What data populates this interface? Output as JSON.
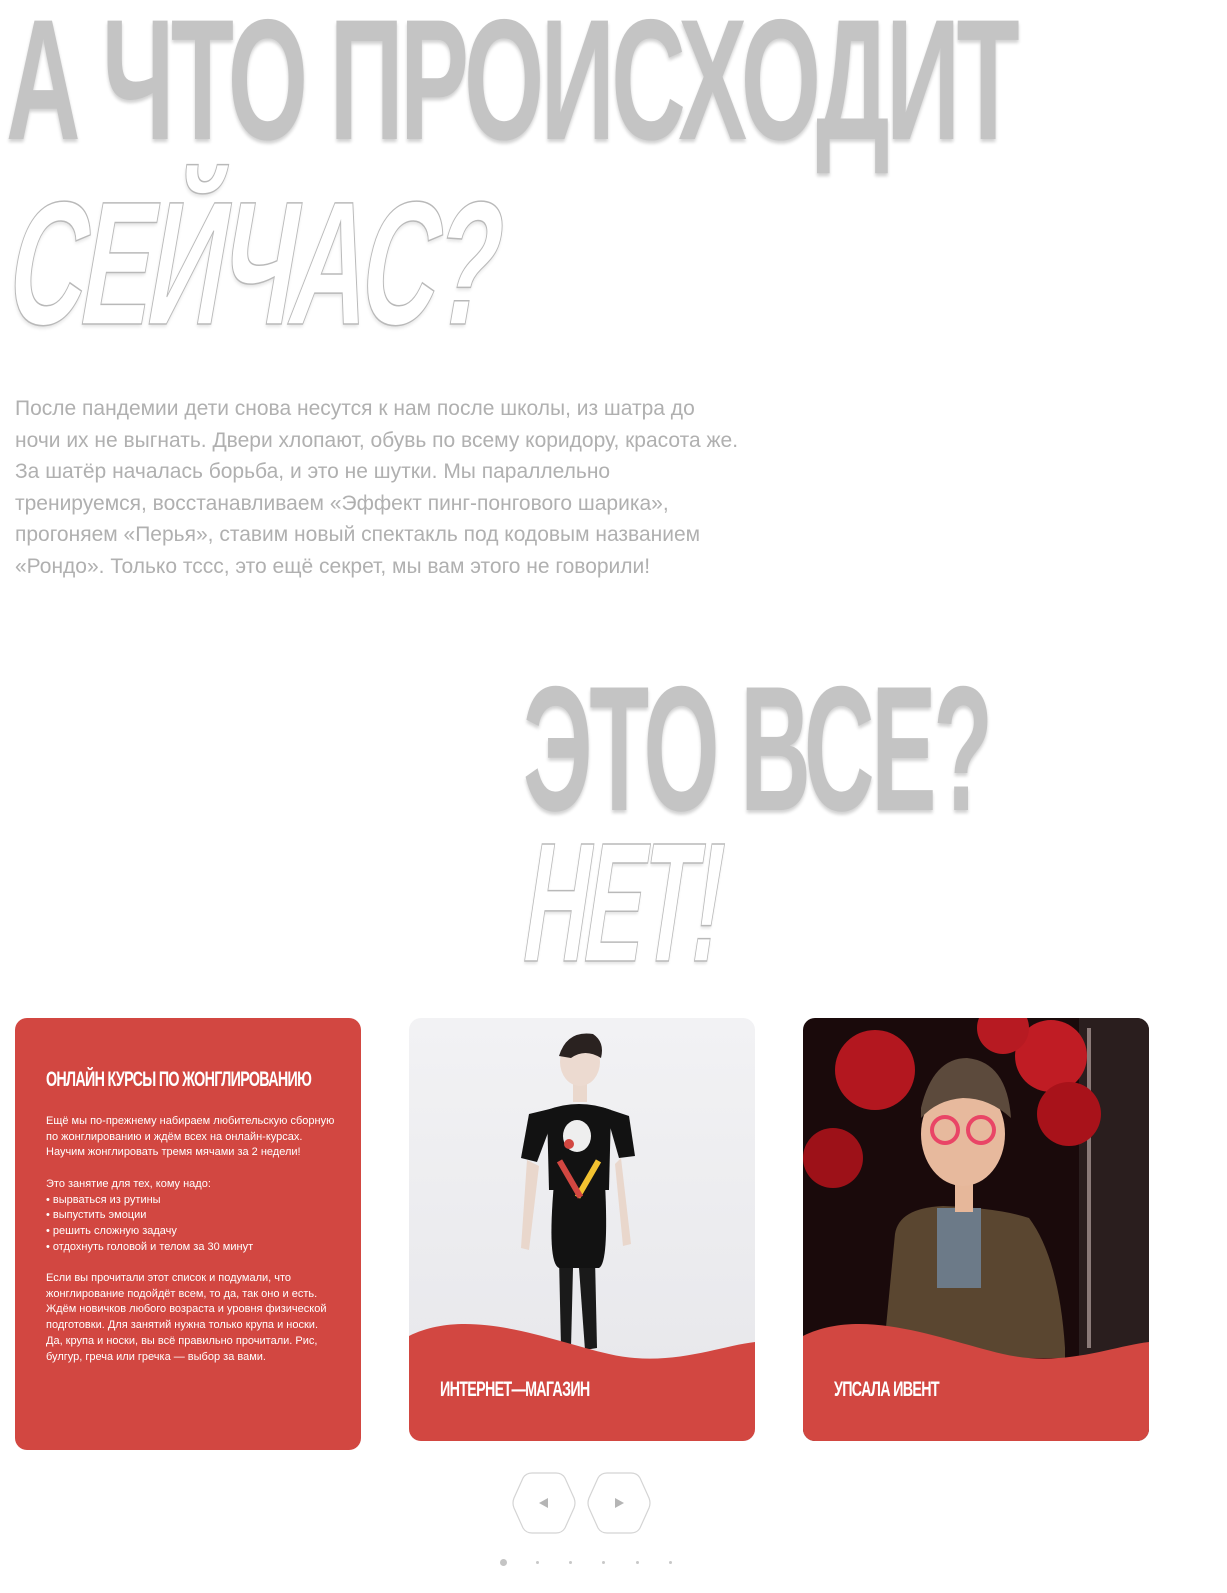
{
  "hero": {
    "line1": "А что происходит",
    "line2": "сейчас?"
  },
  "intro_text": "После пандемии дети снова несутся к нам после школы, из шатра до ночи их не выгнать. Двери хлопают, обувь по всему коридору, красота же. За шатёр началась борьба, и это не шутки. Мы параллельно тренируемся, восстанавливаем «Эффект пинг-понгового шарика», прогоняем «Перья», ставим новый спектакль под кодовым названием «Рондо». Только тссс, это ещё секрет, мы вам этого не говорили!",
  "section2": {
    "line1": "Это все?",
    "line2": "Нет!"
  },
  "cards": {
    "courses": {
      "title": "Онлайн курсы по жонглированию",
      "paragraph1": "Ещё мы по-прежнему набираем любительскую сборную по жонглированию и ждём всех на онлайн-курсах. Научим жонглировать тремя мячами за 2 недели!",
      "paragraph2": "Это занятие для тех, кому надо:",
      "bullets": [
        "вырваться из рутины",
        "выпустить эмоции",
        "решить сложную задачу",
        "отдохнуть головой и телом за 30 минут"
      ],
      "paragraph3": "Если вы прочитали этот список и подумали, что жонглирование подойдёт всем, то да, так оно и есть. Ждём новичков любого возраста и уровня физической подготовки. Для занятий нужна только крупа и носки. Да, крупа и носки, вы всё правильно прочитали. Рис, булгур, греча или гречка — выбор за вами."
    },
    "shop": {
      "label": "Интернет—магазин"
    },
    "event": {
      "label": "Упсала ивент"
    }
  },
  "carousel": {
    "prev_icon": "triangle-left",
    "next_icon": "triangle-right",
    "dot_count": 6,
    "active_index": 0
  },
  "colors": {
    "brand_red": "#d24741",
    "headline_gray": "#c4c4c4",
    "body_text_gray": "#b0b0b0"
  }
}
